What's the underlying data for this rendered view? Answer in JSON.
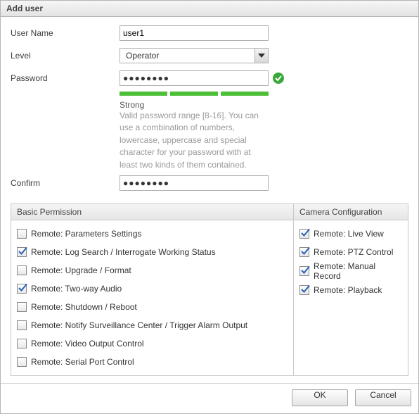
{
  "dialog": {
    "title": "Add user"
  },
  "form": {
    "username_label": "User Name",
    "username_value": "user1",
    "level_label": "Level",
    "level_value": "Operator",
    "password_label": "Password",
    "password_value": "●●●●●●●●",
    "confirm_label": "Confirm",
    "confirm_value": "●●●●●●●●",
    "strength_label": "Strong",
    "strength_hint": "Valid password range [8-16]. You can use a combination of numbers, lowercase, uppercase and special character for your password with at least two kinds of them contained."
  },
  "permissions": {
    "basic_header": "Basic Permission",
    "basic": [
      {
        "label": "Remote: Parameters Settings",
        "checked": false
      },
      {
        "label": "Remote: Log Search / Interrogate Working Status",
        "checked": true
      },
      {
        "label": "Remote: Upgrade / Format",
        "checked": false
      },
      {
        "label": "Remote: Two-way Audio",
        "checked": true
      },
      {
        "label": "Remote: Shutdown / Reboot",
        "checked": false
      },
      {
        "label": "Remote: Notify Surveillance Center / Trigger Alarm Output",
        "checked": false
      },
      {
        "label": "Remote: Video Output Control",
        "checked": false
      },
      {
        "label": "Remote: Serial Port Control",
        "checked": false
      }
    ],
    "camera_header": "Camera Configuration",
    "camera": [
      {
        "label": "Remote: Live View",
        "checked": true
      },
      {
        "label": "Remote: PTZ Control",
        "checked": true
      },
      {
        "label": "Remote: Manual Record",
        "checked": true
      },
      {
        "label": "Remote: Playback",
        "checked": true
      }
    ]
  },
  "buttons": {
    "ok": "OK",
    "cancel": "Cancel"
  }
}
